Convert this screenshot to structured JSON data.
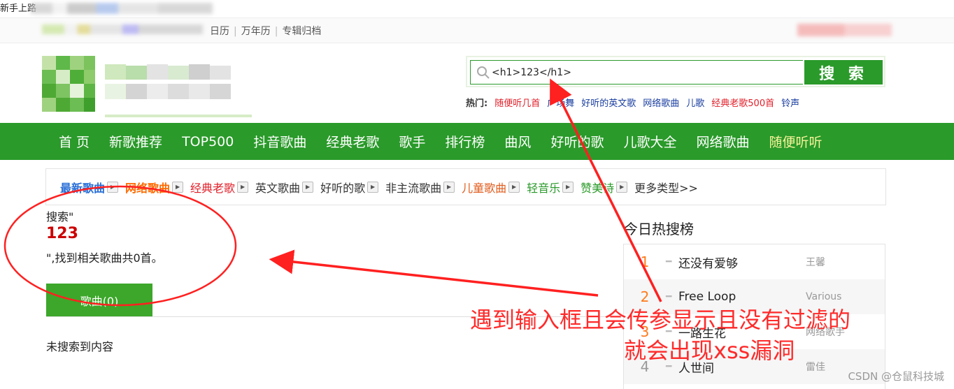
{
  "topbar": {
    "left_text": "新手上路"
  },
  "subbar": {
    "links": [
      "日历",
      "万年历",
      "专辑归档"
    ]
  },
  "search": {
    "value": "<h1>123</h1>",
    "button_label": "搜 索",
    "hot_label": "热门:",
    "hot_terms": [
      {
        "text": "随便听几首",
        "color": "#e0202a"
      },
      {
        "text": "广场舞",
        "color": "#1a3ea0"
      },
      {
        "text": "好听的英文歌",
        "color": "#1a3ea0"
      },
      {
        "text": "网络歌曲",
        "color": "#1a3ea0"
      },
      {
        "text": "儿歌",
        "color": "#1a3ea0"
      },
      {
        "text": "经典老歌500首",
        "color": "#e0202a"
      },
      {
        "text": "铃声",
        "color": "#1a3ea0"
      }
    ]
  },
  "nav": {
    "items": [
      "首 页",
      "新歌推荐",
      "TOP500",
      "抖音歌曲",
      "经典老歌",
      "歌手",
      "排行榜",
      "曲风",
      "好听的歌",
      "儿歌大全",
      "网络歌曲",
      "随便听听"
    ]
  },
  "genres": [
    {
      "text": "最新歌曲",
      "color": "#2a6fd6"
    },
    {
      "text": "网络歌曲",
      "color": "#ff6a00"
    },
    {
      "text": "经典老歌",
      "color": "#e0202a"
    },
    {
      "text": "英文歌曲",
      "color": "#333333"
    },
    {
      "text": "好听的歌",
      "color": "#333333"
    },
    {
      "text": "非主流歌曲",
      "color": "#333333"
    },
    {
      "text": "儿童歌曲",
      "color": "#e05a1a"
    },
    {
      "text": "轻音乐",
      "color": "#2a9a2a"
    },
    {
      "text": "赞美诗",
      "color": "#2a9a2a"
    },
    {
      "text": "更多类型>>",
      "color": "#333333"
    }
  ],
  "results": {
    "label": "搜索\"",
    "injected_h1": "123",
    "found_text": "\",找到相关歌曲共0首。",
    "tab_label": "歌曲(0)",
    "empty_text": "未搜索到内容"
  },
  "hotlist": {
    "title": "今日热搜榜",
    "rows": [
      {
        "num": "1",
        "title": "还没有爱够",
        "artist": "王馨"
      },
      {
        "num": "2",
        "title": "Free Loop",
        "artist": "Various"
      },
      {
        "num": "3",
        "title": "一路生花",
        "artist": "网络歌手"
      },
      {
        "num": "4",
        "title": "人世间",
        "artist": "雷佳"
      }
    ]
  },
  "annotation": {
    "line1": "遇到输入框且会传参显示且没有过滤的",
    "line2": "就会出现xss漏洞"
  },
  "watermark": "CSDN @仓鼠科技城"
}
